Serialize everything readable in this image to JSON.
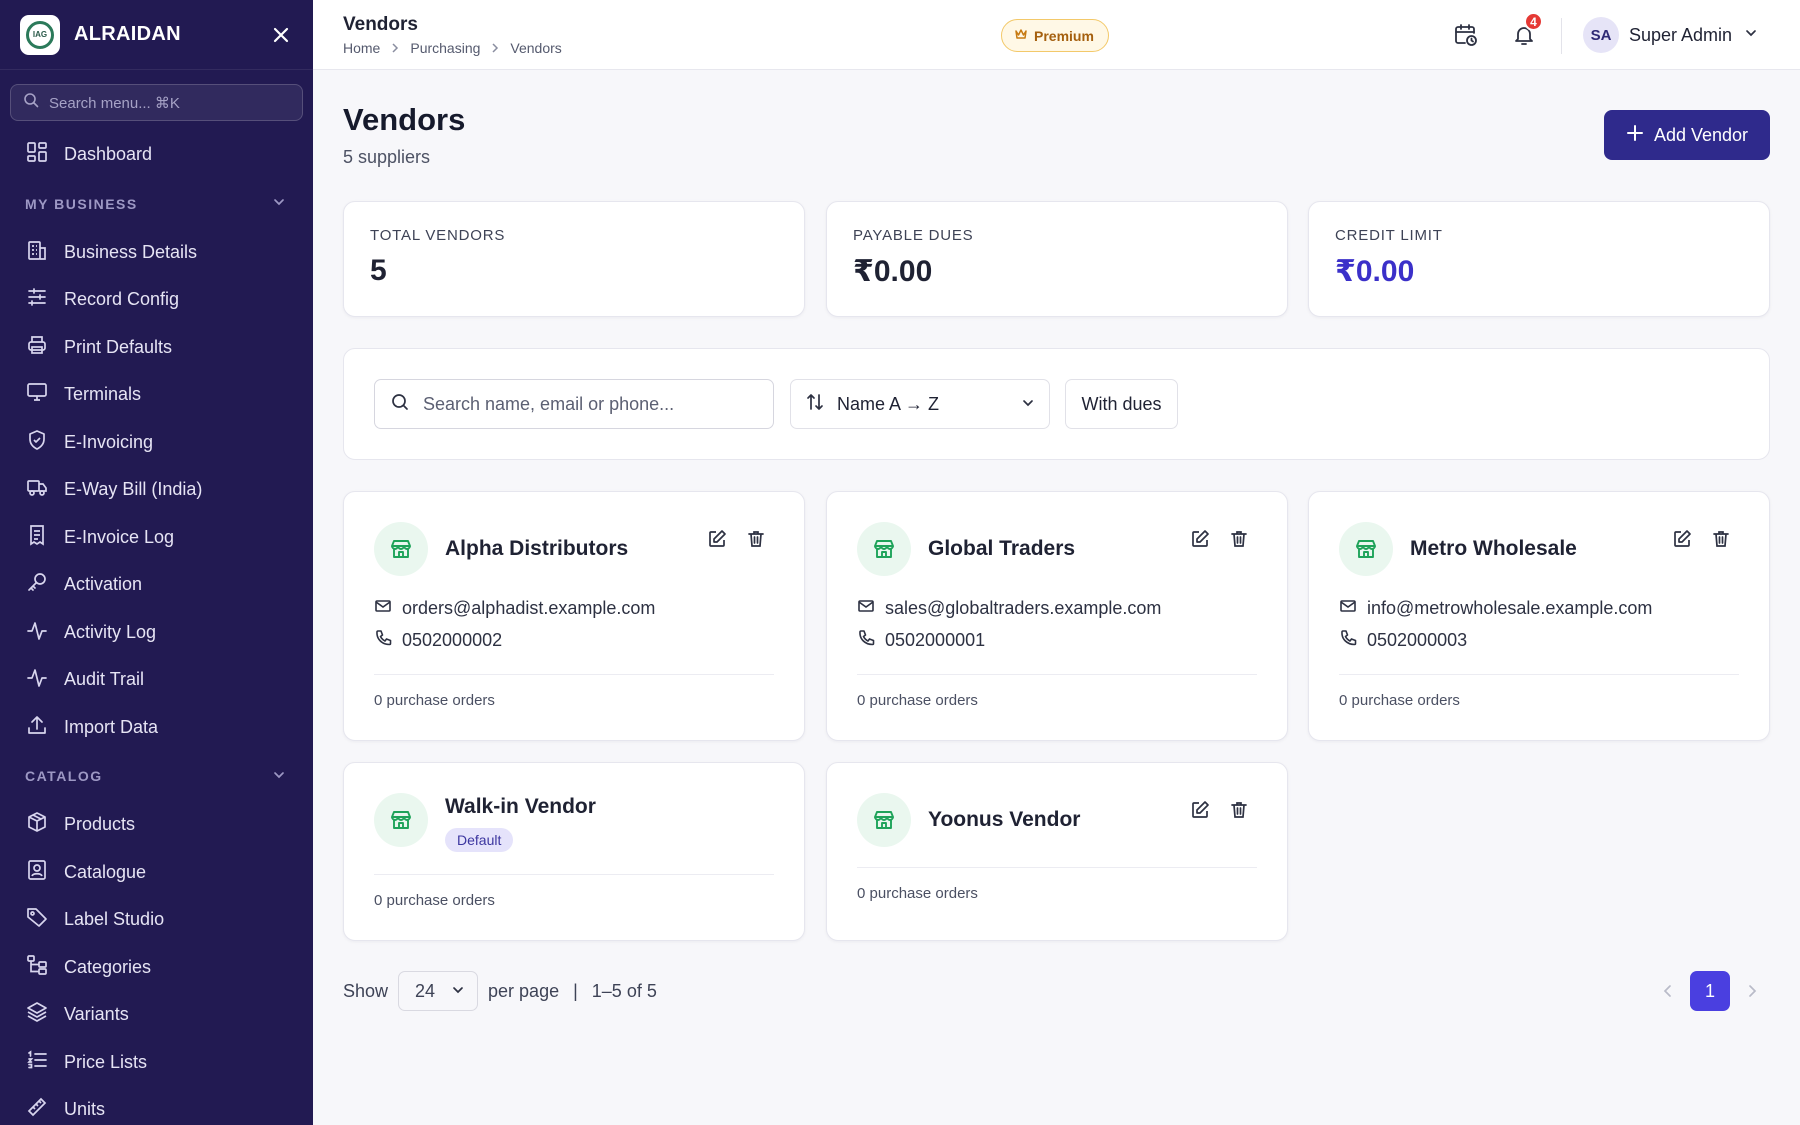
{
  "sidebar": {
    "brand": "ALRAIDAN",
    "logo_text": "IAG",
    "search_placeholder": "Search menu... ⌘K",
    "items_top": [
      {
        "label": "Dashboard",
        "icon": "dashboard-icon"
      }
    ],
    "section_business": "MY BUSINESS",
    "items_business": [
      {
        "label": "Business Details",
        "icon": "building-icon"
      },
      {
        "label": "Record Config",
        "icon": "sliders-icon"
      },
      {
        "label": "Print Defaults",
        "icon": "printer-icon"
      },
      {
        "label": "Terminals",
        "icon": "monitor-icon"
      },
      {
        "label": "E-Invoicing",
        "icon": "shield-check-icon"
      },
      {
        "label": "E-Way Bill (India)",
        "icon": "truck-icon"
      },
      {
        "label": "E-Invoice Log",
        "icon": "receipt-icon"
      },
      {
        "label": "Activation",
        "icon": "key-icon"
      },
      {
        "label": "Activity Log",
        "icon": "activity-icon"
      },
      {
        "label": "Audit Trail",
        "icon": "activity-icon"
      },
      {
        "label": "Import Data",
        "icon": "upload-icon"
      }
    ],
    "section_catalog": "CATALOG",
    "items_catalog": [
      {
        "label": "Products",
        "icon": "package-icon"
      },
      {
        "label": "Catalogue",
        "icon": "image-icon"
      },
      {
        "label": "Label Studio",
        "icon": "tag-icon"
      },
      {
        "label": "Categories",
        "icon": "tree-icon"
      },
      {
        "label": "Variants",
        "icon": "layers-icon"
      },
      {
        "label": "Price Lists",
        "icon": "list-icon"
      },
      {
        "label": "Units",
        "icon": "ruler-icon"
      }
    ]
  },
  "topbar": {
    "title": "Vendors",
    "breadcrumb": [
      "Home",
      "Purchasing",
      "Vendors"
    ],
    "premium_label": "Premium",
    "notification_count": "4",
    "user_initials": "SA",
    "user_name": "Super Admin"
  },
  "page": {
    "title": "Vendors",
    "subtitle": "5 suppliers",
    "add_label": "Add Vendor"
  },
  "stats": [
    {
      "label": "TOTAL VENDORS",
      "value": "5",
      "color": "#1f2233"
    },
    {
      "label": "PAYABLE DUES",
      "value": "₹0.00",
      "color": "#1f2233"
    },
    {
      "label": "CREDIT LIMIT",
      "value": "₹0.00",
      "color": "#3b30c9"
    }
  ],
  "filters": {
    "search_placeholder": "Search name, email or phone...",
    "sort_label": "Name A → Z",
    "dues_label": "With dues"
  },
  "vendors": [
    {
      "name": "Alpha Distributors",
      "email": "orders@alphadist.example.com",
      "phone": "0502000002",
      "orders": "0 purchase orders"
    },
    {
      "name": "Global Traders",
      "email": "sales@globaltraders.example.com",
      "phone": "0502000001",
      "orders": "0 purchase orders"
    },
    {
      "name": "Metro Wholesale",
      "email": "info@metrowholesale.example.com",
      "phone": "0502000003",
      "orders": "0 purchase orders"
    },
    {
      "name": "Walk-in Vendor",
      "badge": "Default",
      "orders": "0 purchase orders"
    },
    {
      "name": "Yoonus Vendor",
      "orders": "0 purchase orders"
    }
  ],
  "pagination": {
    "show_label": "Show",
    "per_page_value": "24",
    "per_page_label": "per page",
    "separator": "|",
    "range_label": "1–5 of 5",
    "current_page": "1"
  },
  "colors": {
    "sidebar_bg": "#221a52",
    "accent": "#2f2a8c",
    "page_active": "#4a3fe0",
    "vendor_icon": "#1fa35a",
    "premium": "#a5600f"
  }
}
